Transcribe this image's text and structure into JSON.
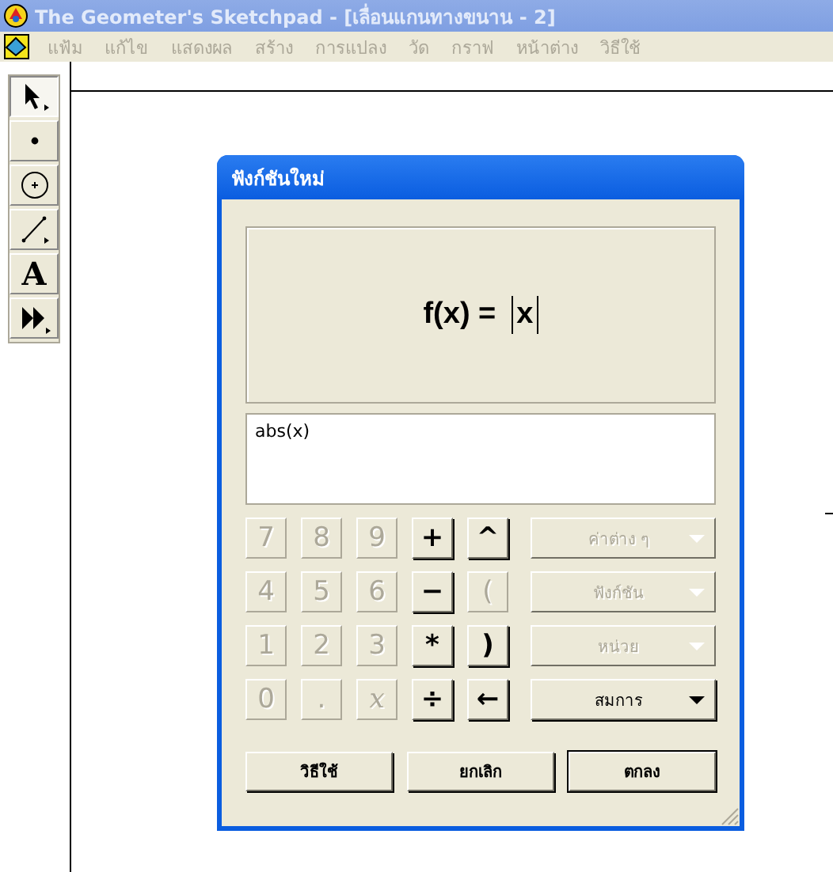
{
  "window": {
    "title": "The Geometer's Sketchpad - [เลื่อนแกนทางขนาน - 2]"
  },
  "menu": [
    {
      "label": "แฟ้ม",
      "disabled": true
    },
    {
      "label": "แก้ไข",
      "disabled": true
    },
    {
      "label": "แสดงผล",
      "disabled": true
    },
    {
      "label": "สร้าง",
      "disabled": true
    },
    {
      "label": "การแปลง",
      "disabled": true
    },
    {
      "label": "วัด",
      "disabled": true
    },
    {
      "label": "กราฟ",
      "disabled": true
    },
    {
      "label": "หน้าต่าง",
      "disabled": true
    },
    {
      "label": "วิธีใช้",
      "disabled": true
    }
  ],
  "tools": [
    {
      "kind": "arrow",
      "selected": true
    },
    {
      "kind": "point",
      "selected": false
    },
    {
      "kind": "compass",
      "selected": false
    },
    {
      "kind": "line",
      "selected": false
    },
    {
      "kind": "text",
      "selected": false,
      "label": "A"
    },
    {
      "kind": "custom",
      "selected": false
    }
  ],
  "dialog": {
    "title": "ฟังก์ชันใหม่",
    "preview": {
      "lhs": "f(x) =",
      "arg": "x"
    },
    "expression": "abs(x)",
    "keys": [
      {
        "label": "7",
        "kind": "digit",
        "disabled": true
      },
      {
        "label": "8",
        "kind": "digit",
        "disabled": true
      },
      {
        "label": "9",
        "kind": "digit",
        "disabled": true
      },
      {
        "label": "+",
        "kind": "op",
        "disabled": false
      },
      {
        "label": "^",
        "kind": "op",
        "disabled": false
      },
      {
        "label": "4",
        "kind": "digit",
        "disabled": true
      },
      {
        "label": "5",
        "kind": "digit",
        "disabled": true
      },
      {
        "label": "6",
        "kind": "digit",
        "disabled": true
      },
      {
        "label": "−",
        "kind": "op",
        "disabled": false
      },
      {
        "label": "(",
        "kind": "op",
        "disabled": true
      },
      {
        "label": "1",
        "kind": "digit",
        "disabled": true
      },
      {
        "label": "2",
        "kind": "digit",
        "disabled": true
      },
      {
        "label": "3",
        "kind": "digit",
        "disabled": true
      },
      {
        "label": "*",
        "kind": "op",
        "disabled": false
      },
      {
        "label": ")",
        "kind": "op",
        "disabled": false
      },
      {
        "label": "0",
        "kind": "digit",
        "disabled": true
      },
      {
        "label": ".",
        "kind": "digit",
        "disabled": true
      },
      {
        "label": "x",
        "kind": "variable",
        "disabled": true
      },
      {
        "label": "÷",
        "kind": "op",
        "disabled": false
      },
      {
        "label": "←",
        "kind": "op",
        "disabled": false
      }
    ],
    "dropdowns": [
      {
        "label": "ค่าต่าง ๆ",
        "disabled": true
      },
      {
        "label": "ฟังก์ชัน",
        "disabled": true
      },
      {
        "label": "หน่วย",
        "disabled": true
      },
      {
        "label": "สมการ",
        "disabled": false
      }
    ],
    "buttons": [
      {
        "label": "วิธีใช้",
        "default": false
      },
      {
        "label": "ยกเลิก",
        "default": false
      },
      {
        "label": "ตกลง",
        "default": true
      }
    ]
  }
}
